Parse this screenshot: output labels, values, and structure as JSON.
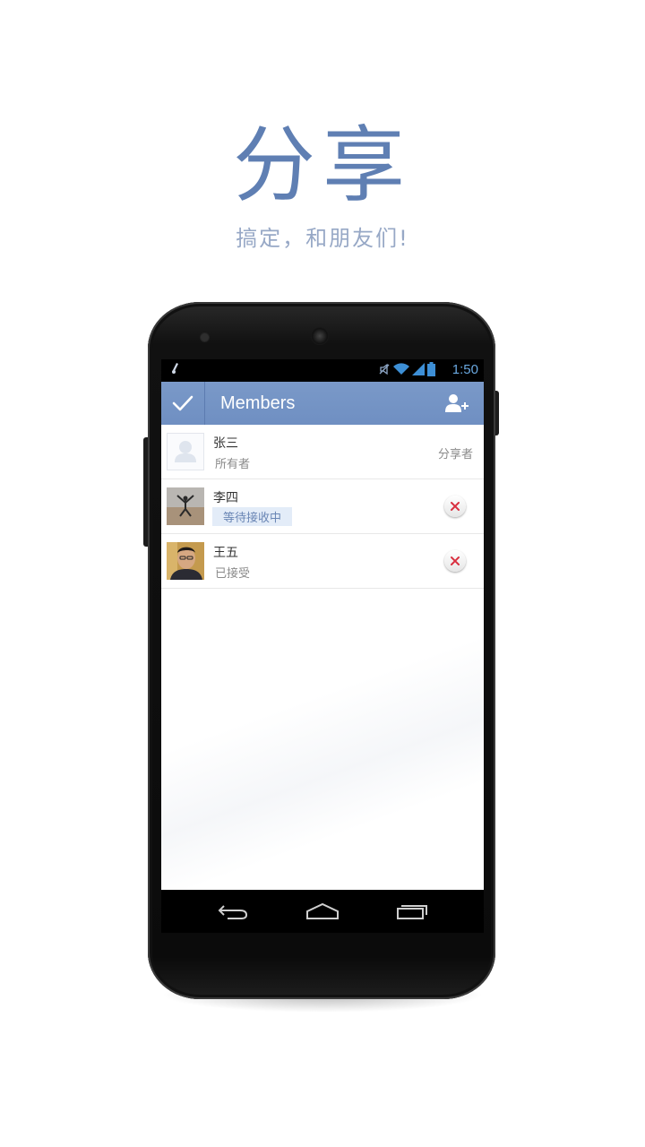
{
  "promo": {
    "title": "分享",
    "subtitle": "搞定，和朋友们!"
  },
  "statusbar": {
    "time": "1:50",
    "icons": [
      "muted-icon",
      "wifi-icon",
      "signal-icon",
      "battery-icon"
    ]
  },
  "actionbar": {
    "title": "Members",
    "confirm_icon": "check-icon",
    "add_icon": "add-user-icon"
  },
  "members": [
    {
      "name": "张三",
      "status": "所有者",
      "role": "分享者"
    },
    {
      "name": "李四",
      "status": "等待接收中"
    },
    {
      "name": "王五",
      "status": "已接受"
    }
  ],
  "navbar": {
    "icons": [
      "back-icon",
      "home-icon",
      "recents-icon"
    ]
  },
  "colors": {
    "accent": "#6f8fc2",
    "title_text": "#5f7fb3",
    "remove_red": "#d93040"
  }
}
